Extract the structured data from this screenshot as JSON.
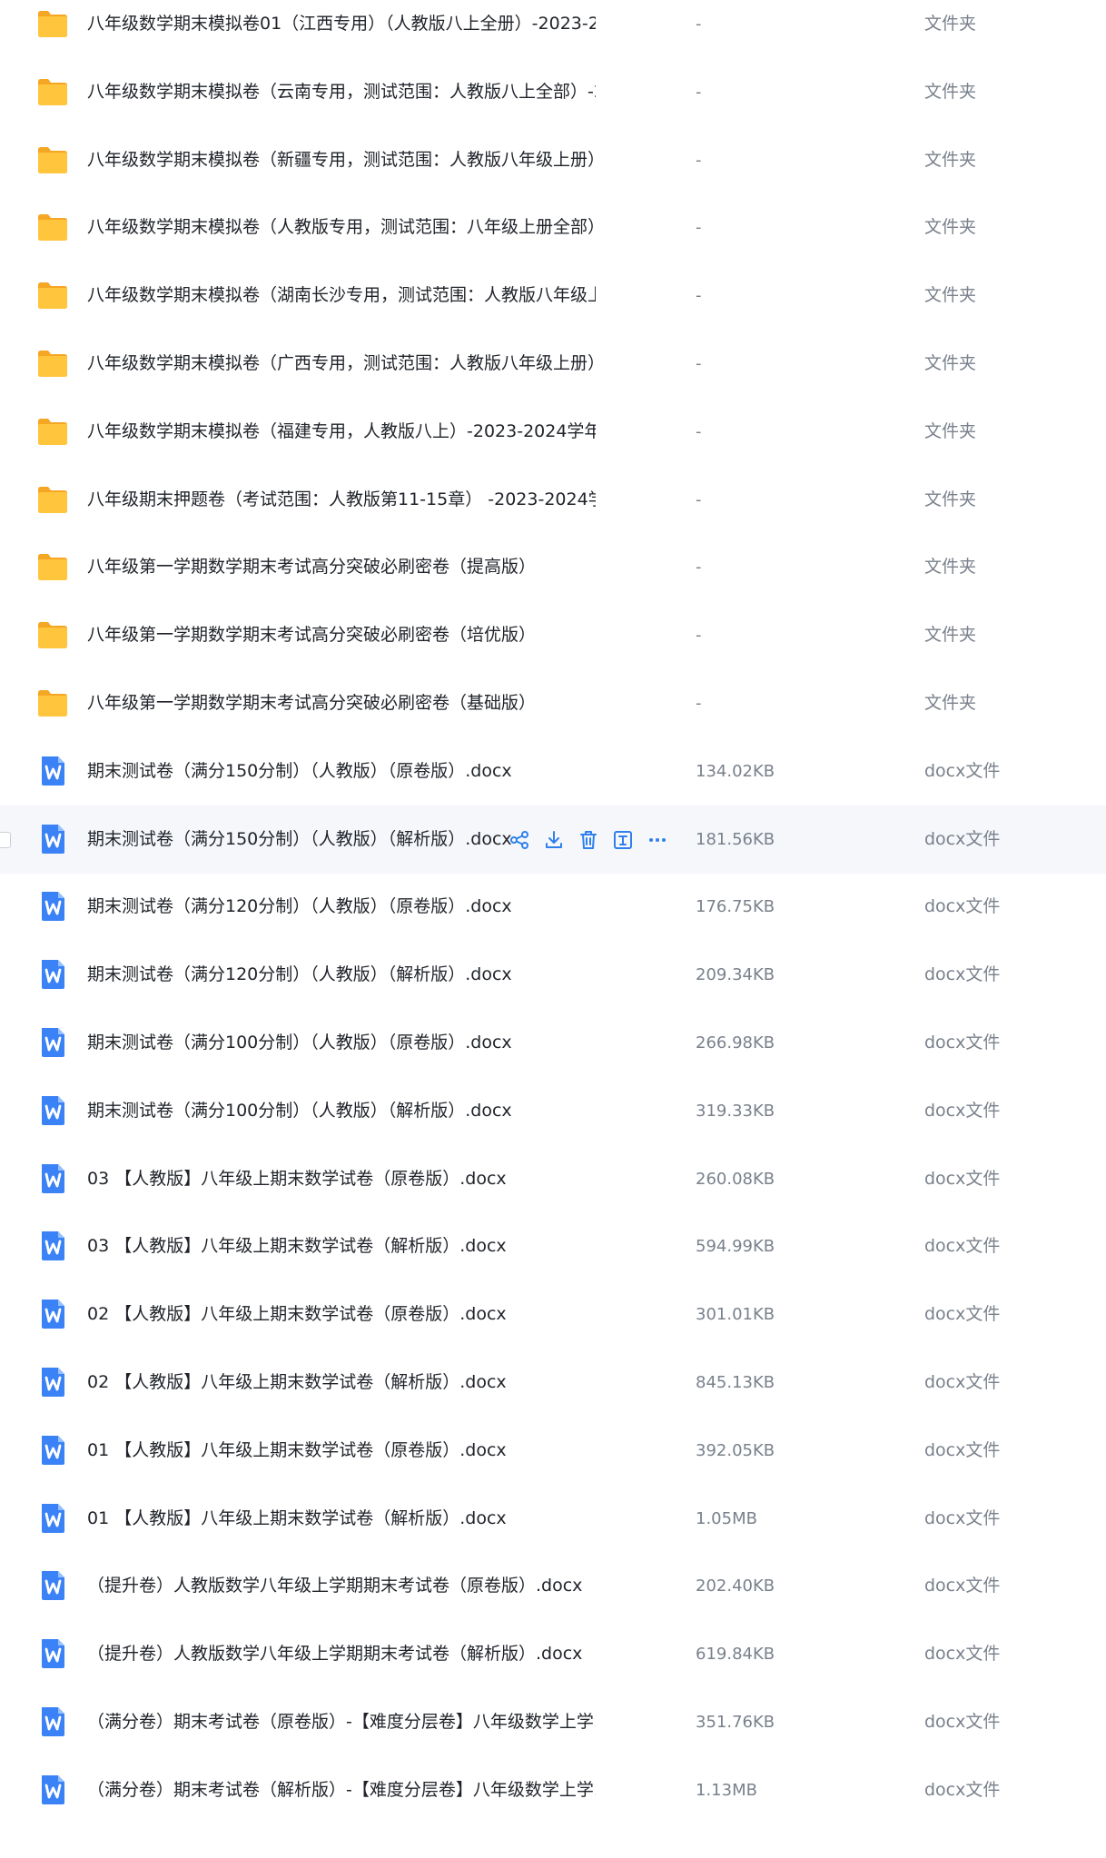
{
  "files": [
    {
      "name": "八年级数学期末模拟卷01（江西专用）（人教版八上全册）-2023-2...",
      "size": "-",
      "type": "文件夹",
      "kind": "folder"
    },
    {
      "name": "八年级数学期末模拟卷（云南专用，测试范围：人教版八上全部）-2...",
      "size": "-",
      "type": "文件夹",
      "kind": "folder"
    },
    {
      "name": "八年级数学期末模拟卷（新疆专用，测试范围：人教版八年级上册）...",
      "size": "-",
      "type": "文件夹",
      "kind": "folder"
    },
    {
      "name": "八年级数学期末模拟卷（人教版专用，测试范围：八年级上册全部）...",
      "size": "-",
      "type": "文件夹",
      "kind": "folder"
    },
    {
      "name": "八年级数学期末模拟卷（湖南长沙专用，测试范围：人教版八年级上...",
      "size": "-",
      "type": "文件夹",
      "kind": "folder"
    },
    {
      "name": "八年级数学期末模拟卷（广西专用，测试范围：人教版八年级上册）...",
      "size": "-",
      "type": "文件夹",
      "kind": "folder"
    },
    {
      "name": "八年级数学期末模拟卷（福建专用，人教版八上）-2023-2024学年...",
      "size": "-",
      "type": "文件夹",
      "kind": "folder"
    },
    {
      "name": "八年级期末押题卷（考试范围：人教版第11-15章） -2023-2024学...",
      "size": "-",
      "type": "文件夹",
      "kind": "folder"
    },
    {
      "name": "八年级第一学期数学期末考试高分突破必刷密卷（提高版）",
      "size": "-",
      "type": "文件夹",
      "kind": "folder"
    },
    {
      "name": "八年级第一学期数学期末考试高分突破必刷密卷（培优版）",
      "size": "-",
      "type": "文件夹",
      "kind": "folder"
    },
    {
      "name": "八年级第一学期数学期末考试高分突破必刷密卷（基础版）",
      "size": "-",
      "type": "文件夹",
      "kind": "folder"
    },
    {
      "name": "期末测试卷（满分150分制）（人教版）（原卷版）.docx",
      "size": "134.02KB",
      "type": "docx文件",
      "kind": "doc"
    },
    {
      "name": "期末测试卷（满分150分制）（人教版）（解析版）.docx",
      "size": "181.56KB",
      "type": "docx文件",
      "kind": "doc",
      "selected": true
    },
    {
      "name": "期末测试卷（满分120分制）（人教版）（原卷版）.docx",
      "size": "176.75KB",
      "type": "docx文件",
      "kind": "doc"
    },
    {
      "name": "期末测试卷（满分120分制）（人教版）（解析版）.docx",
      "size": "209.34KB",
      "type": "docx文件",
      "kind": "doc"
    },
    {
      "name": "期末测试卷（满分100分制）（人教版）（原卷版）.docx",
      "size": "266.98KB",
      "type": "docx文件",
      "kind": "doc"
    },
    {
      "name": "期末测试卷（满分100分制）（人教版）（解析版）.docx",
      "size": "319.33KB",
      "type": "docx文件",
      "kind": "doc"
    },
    {
      "name": "03 【人教版】八年级上期末数学试卷（原卷版）.docx",
      "size": "260.08KB",
      "type": "docx文件",
      "kind": "doc"
    },
    {
      "name": "03 【人教版】八年级上期末数学试卷（解析版）.docx",
      "size": "594.99KB",
      "type": "docx文件",
      "kind": "doc"
    },
    {
      "name": "02 【人教版】八年级上期末数学试卷（原卷版）.docx",
      "size": "301.01KB",
      "type": "docx文件",
      "kind": "doc"
    },
    {
      "name": "02 【人教版】八年级上期末数学试卷（解析版）.docx",
      "size": "845.13KB",
      "type": "docx文件",
      "kind": "doc"
    },
    {
      "name": "01 【人教版】八年级上期末数学试卷（原卷版）.docx",
      "size": "392.05KB",
      "type": "docx文件",
      "kind": "doc"
    },
    {
      "name": "01 【人教版】八年级上期末数学试卷（解析版）.docx",
      "size": "1.05MB",
      "type": "docx文件",
      "kind": "doc"
    },
    {
      "name": "（提升卷）人教版数学八年级上学期期末考试卷（原卷版）.docx",
      "size": "202.40KB",
      "type": "docx文件",
      "kind": "doc"
    },
    {
      "name": "（提升卷）人教版数学八年级上学期期末考试卷（解析版）.docx",
      "size": "619.84KB",
      "type": "docx文件",
      "kind": "doc"
    },
    {
      "name": "（满分卷）期末考试卷（原卷版）-【难度分层卷】八年级数学上学...",
      "size": "351.76KB",
      "type": "docx文件",
      "kind": "doc"
    },
    {
      "name": "（满分卷）期末考试卷（解析版）-【难度分层卷】八年级数学上学...",
      "size": "1.13MB",
      "type": "docx文件",
      "kind": "doc"
    }
  ],
  "row_actions": [
    "share-icon",
    "download-icon",
    "delete-icon",
    "rename-icon",
    "more-icon"
  ],
  "colors": {
    "folder": "#ffc53d",
    "folder_tab": "#f5a623",
    "doc": "#3b82f6",
    "action": "#2f80ed",
    "selected_bg": "#f5f7fb"
  }
}
